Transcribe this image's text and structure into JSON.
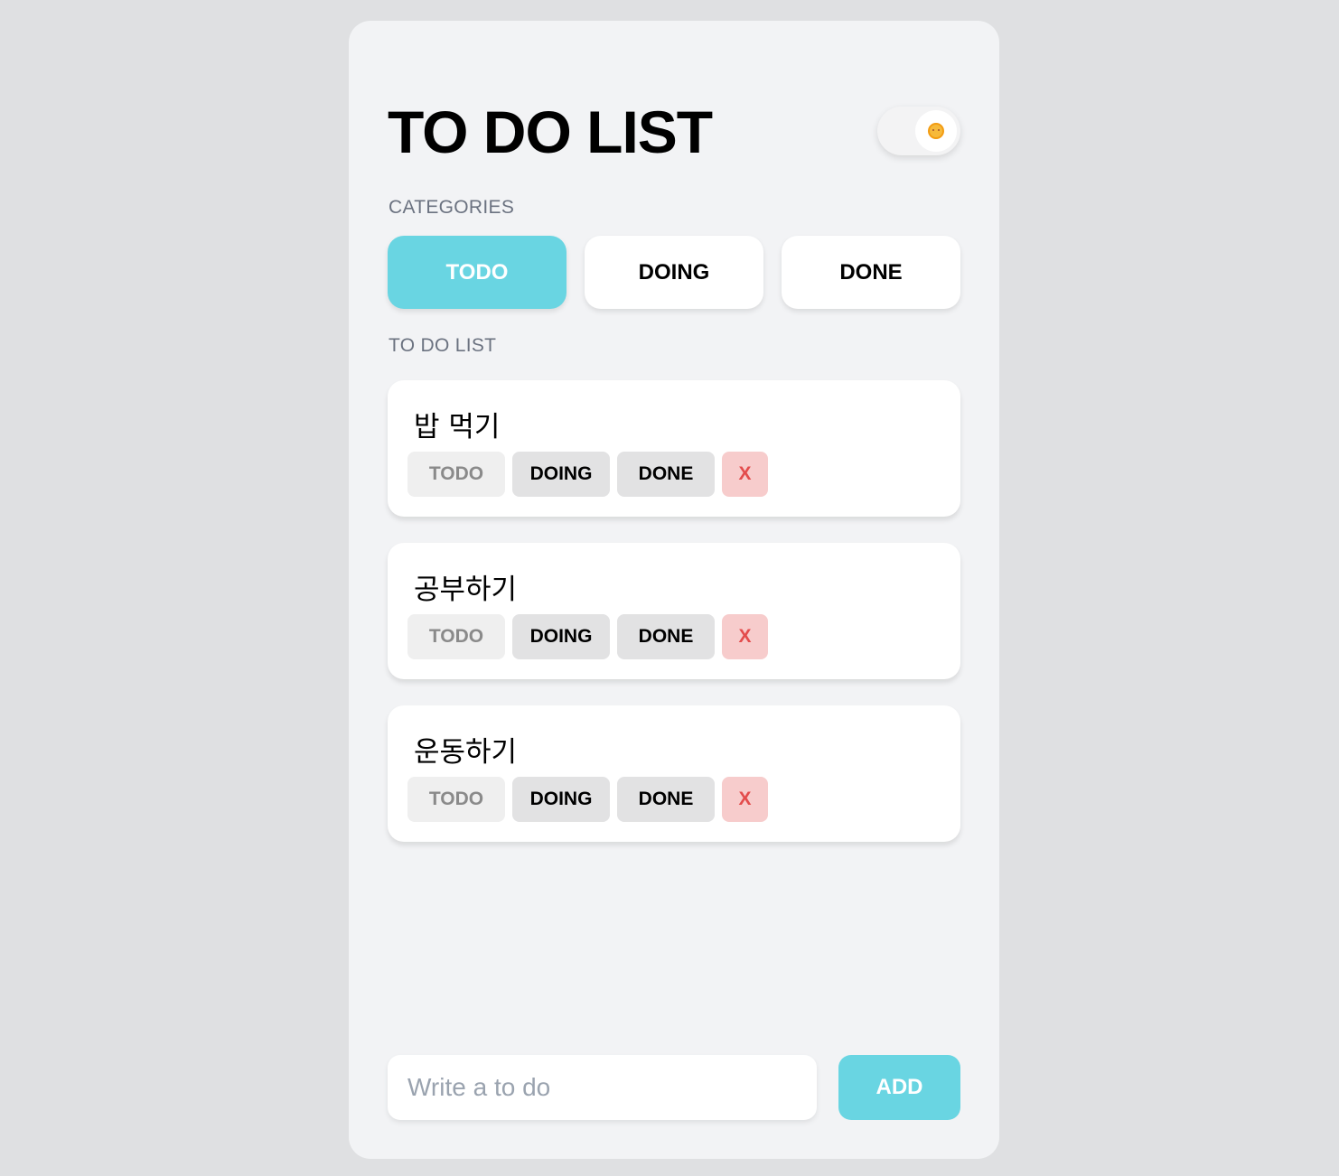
{
  "header": {
    "title": "TO DO LIST",
    "theme_toggle": {
      "state": "light",
      "icon": "sun-icon"
    }
  },
  "categories": {
    "label": "CATEGORIES",
    "items": [
      {
        "label": "TODO",
        "active": true
      },
      {
        "label": "DOING",
        "active": false
      },
      {
        "label": "DONE",
        "active": false
      }
    ]
  },
  "list": {
    "label": "TO DO LIST",
    "items": [
      {
        "text": "밥 먹기",
        "actions": {
          "todo": "TODO",
          "doing": "DOING",
          "done": "DONE",
          "delete": "X"
        }
      },
      {
        "text": "공부하기",
        "actions": {
          "todo": "TODO",
          "doing": "DOING",
          "done": "DONE",
          "delete": "X"
        }
      },
      {
        "text": "운동하기",
        "actions": {
          "todo": "TODO",
          "doing": "DOING",
          "done": "DONE",
          "delete": "X"
        }
      }
    ]
  },
  "form": {
    "input_value": "",
    "placeholder": "Write a to do",
    "add_label": "ADD"
  },
  "colors": {
    "accent": "#69d5e2",
    "delete_text": "#e34c4c",
    "delete_bg": "#f7cccc",
    "page_bg": "#dfe0e2",
    "panel_bg": "#f2f3f5"
  }
}
